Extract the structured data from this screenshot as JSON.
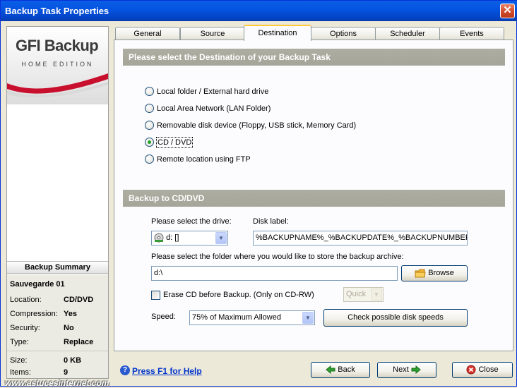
{
  "window": {
    "title": "Backup Task Properties",
    "close_symbol": "✕"
  },
  "logo": {
    "brand": "GFI Backup",
    "edition": "HOME EDITION"
  },
  "summary": {
    "header": "Backup Summary",
    "task_name": "Sauvegarde 01",
    "rows": [
      {
        "key": "Location:",
        "value": "CD/DVD"
      },
      {
        "key": "Compression:",
        "value": "Yes"
      },
      {
        "key": "Security:",
        "value": "No"
      },
      {
        "key": "Type:",
        "value": "Replace"
      }
    ],
    "stats": [
      {
        "key": "Size:",
        "value": "0 KB"
      },
      {
        "key": "Items:",
        "value": "9"
      }
    ]
  },
  "tabs": [
    "General",
    "Source",
    "Destination",
    "Options",
    "Scheduler",
    "Events"
  ],
  "active_tab": "Destination",
  "destination": {
    "header": "Please select the Destination of your Backup Task",
    "options": [
      "Local folder / External hard drive",
      "Local Area Network (LAN Folder)",
      "Removable disk device (Floppy, USB stick, Memory Card)",
      "CD / DVD",
      "Remote location using FTP"
    ],
    "selected": "CD / DVD"
  },
  "cddvd": {
    "header": "Backup to CD/DVD",
    "drive_label": "Please select the drive:",
    "drive_value": "d: []",
    "disk_label_label": "Disk label:",
    "disk_label_value": "%BACKUPNAME%_%BACKUPDATE%_%BACKUPNUMBER%",
    "folder_label": "Please select the folder where you would like to store the backup archive:",
    "folder_value": "d:\\",
    "browse_label": "Browse",
    "erase_label": "Erase CD before Backup. (Only on CD-RW)",
    "erase_checked": false,
    "erase_mode": "Quick",
    "speed_label": "Speed:",
    "speed_value": "75% of Maximum Allowed",
    "check_speeds_label": "Check possible disk speeds"
  },
  "footer": {
    "help_label": "Press F1 for Help",
    "back_label": "Back",
    "next_label": "Next",
    "close_label": "Close"
  },
  "watermark": "www.astucesinternet.com",
  "colors": {
    "titlebar": "#0554e1",
    "section_header": "#a9a99e",
    "active_tab_accent": "#ffc83c",
    "link": "#0033cc",
    "radio_dot": "#21a121"
  }
}
